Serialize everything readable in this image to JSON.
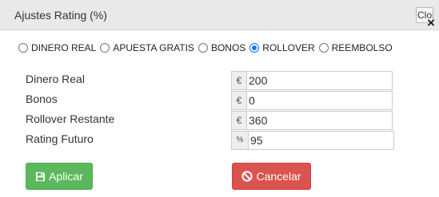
{
  "dialog": {
    "title": "Ajustes Rating (%)",
    "close_label": "Close",
    "close_icon": "×"
  },
  "options": {
    "items": [
      {
        "label": "DINERO REAL",
        "checked": false
      },
      {
        "label": "APUESTA GRATIS",
        "checked": false
      },
      {
        "label": "BONOS",
        "checked": false
      },
      {
        "label": "ROLLOVER",
        "checked": true
      },
      {
        "label": "REEMBOLSO",
        "checked": false
      }
    ]
  },
  "fields": {
    "dinero_real": {
      "label": "Dinero Real",
      "addon": "€",
      "value": "200"
    },
    "bonos": {
      "label": "Bonos",
      "addon": "€",
      "value": "0"
    },
    "rollover": {
      "label": "Rollover Restante",
      "addon": "€",
      "value": "360"
    },
    "rating": {
      "label": "Rating Futuro",
      "addon": "%",
      "value": "95"
    }
  },
  "buttons": {
    "apply_label": "Aplicar",
    "cancel_label": "Cancelar",
    "apply_icon": "save-icon",
    "cancel_icon": "ban-icon"
  },
  "colors": {
    "apply": "#5cb85c",
    "cancel": "#d9534f",
    "radio_accent": "#0075ff"
  }
}
